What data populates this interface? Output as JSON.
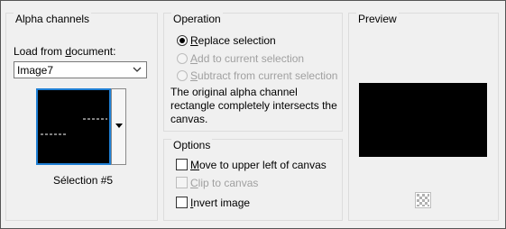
{
  "alpha_channels": {
    "title": "Alpha channels",
    "load_label_pre": "Load from ",
    "load_label_key": "d",
    "load_label_post": "ocument:",
    "document_value": "Image7",
    "selection_name": "Sélection #5"
  },
  "operation": {
    "title": "Operation",
    "options": [
      {
        "key": "R",
        "rest": "eplace selection",
        "selected": true,
        "enabled": true
      },
      {
        "key": "A",
        "rest": "dd to current selection",
        "selected": false,
        "enabled": false
      },
      {
        "key": "S",
        "rest": "ubtract from current selection",
        "selected": false,
        "enabled": false
      }
    ],
    "description_lines": [
      "The original alpha channel",
      "rectangle completely intersects the",
      "canvas."
    ]
  },
  "options": {
    "title": "Options",
    "items": [
      {
        "key": "M",
        "rest": "ove to upper left of canvas",
        "checked": false,
        "enabled": true
      },
      {
        "key": "C",
        "rest": "lip to canvas",
        "checked": false,
        "enabled": false
      },
      {
        "key": "I",
        "rest": "nvert image",
        "checked": false,
        "enabled": true
      }
    ]
  },
  "preview": {
    "title": "Preview",
    "icon": "checkerboard-icon"
  }
}
